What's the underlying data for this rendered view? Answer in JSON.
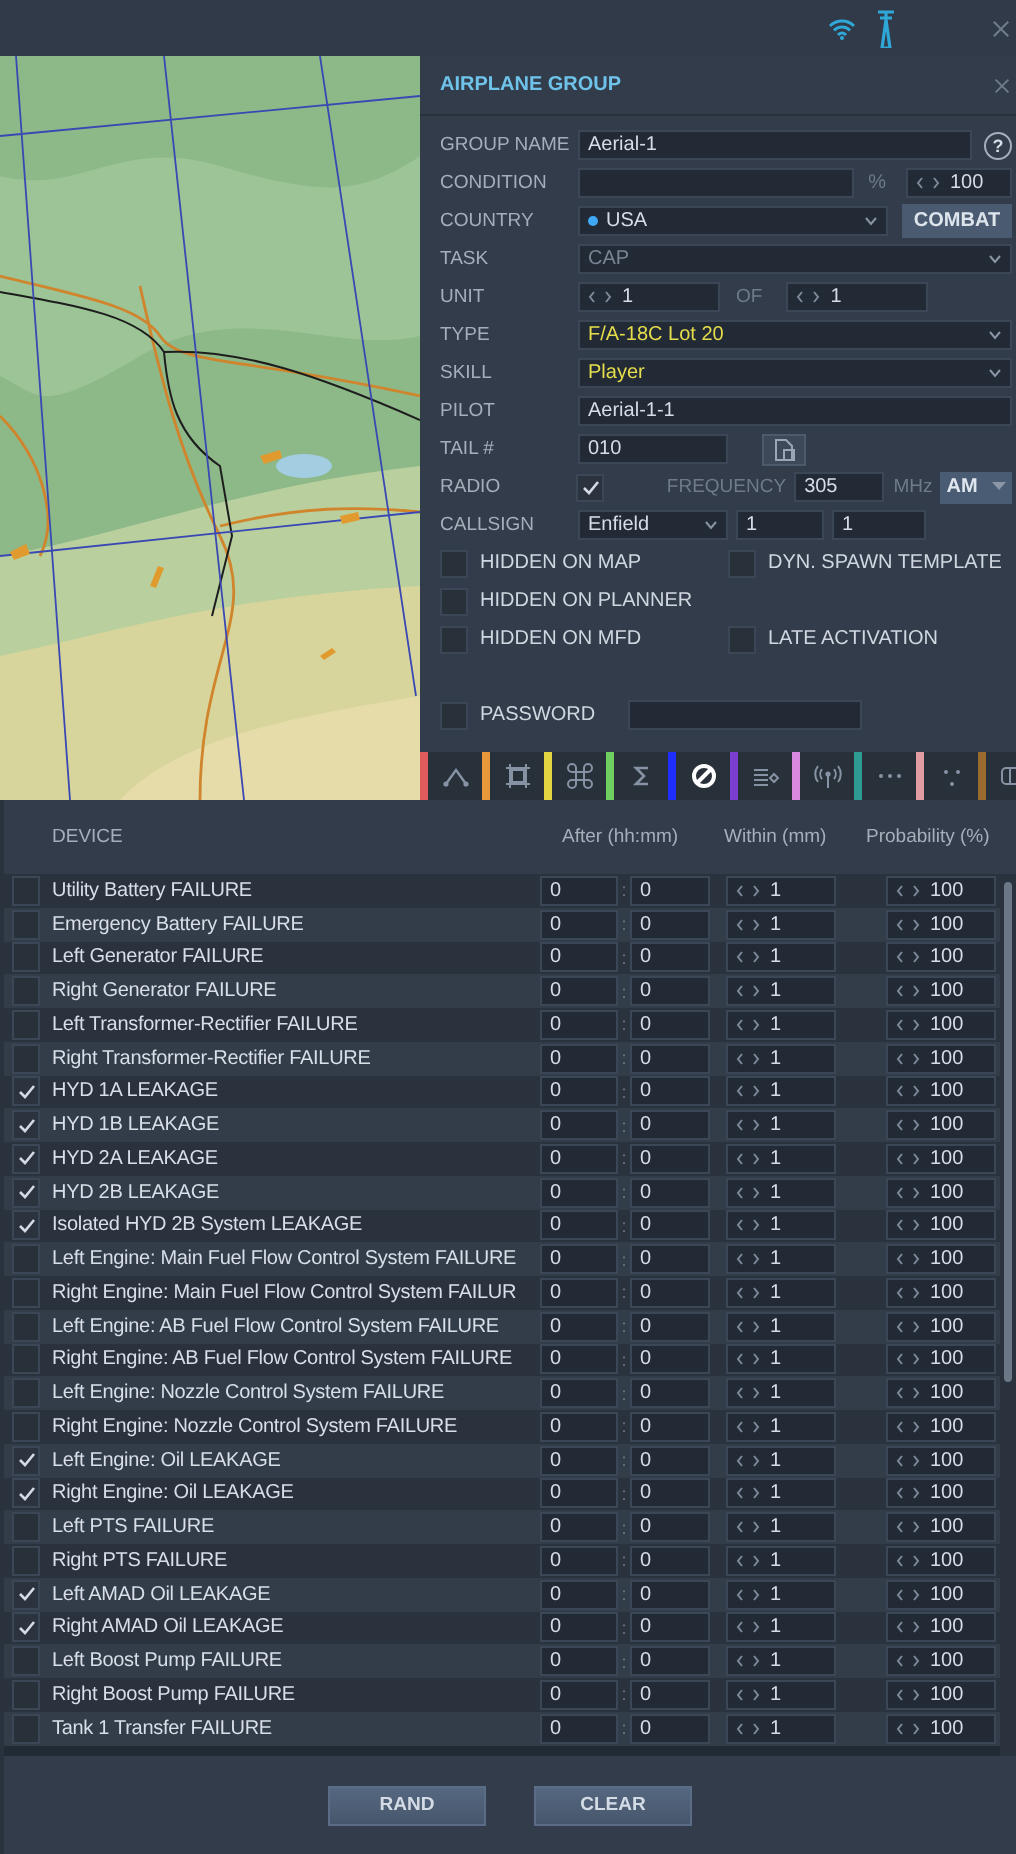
{
  "group": {
    "title": "AIRPLANE GROUP",
    "fields": [
      {
        "kind": "text",
        "label": "GROUP NAME",
        "value": "Aerial-1",
        "help": "?"
      },
      {
        "kind": "condition",
        "label": "CONDITION",
        "unit": "%",
        "amount": "100"
      },
      {
        "kind": "country",
        "label": "COUNTRY",
        "value": "USA",
        "button": "COMBAT"
      },
      {
        "kind": "dropdown",
        "label": "TASK",
        "value": "CAP",
        "disabled": true,
        "highlighted": false
      },
      {
        "kind": "count",
        "label": "UNIT",
        "value": "1",
        "of_label": "OF",
        "total": "1"
      },
      {
        "kind": "dropdown",
        "label": "TYPE",
        "value": "F/A-18C Lot 20",
        "disabled": false,
        "highlighted": true
      },
      {
        "kind": "dropdown",
        "label": "SKILL",
        "value": "Player",
        "disabled": false,
        "highlighted": true
      },
      {
        "kind": "text",
        "label": "PILOT",
        "value": "Aerial-1-1"
      },
      {
        "kind": "tail",
        "label": "TAIL #",
        "value": "010"
      },
      {
        "kind": "radio",
        "label": "RADIO",
        "checked": true,
        "freq_label": "FREQUENCY",
        "frequency": "305",
        "unit": "MHz",
        "band": "AM"
      },
      {
        "kind": "callsign",
        "label": "CALLSIGN",
        "value": "Enfield",
        "flight": "1",
        "number": "1"
      }
    ],
    "option_rows": [
      {
        "items": [
          {
            "label": "HIDDEN ON MAP",
            "checked": false
          },
          {
            "label": "DYN. SPAWN TEMPLATE",
            "checked": false
          }
        ]
      },
      {
        "items": [
          {
            "label": "HIDDEN ON PLANNER",
            "checked": false
          }
        ]
      },
      {
        "items": [
          {
            "label": "HIDDEN ON MFD",
            "checked": false
          },
          {
            "label": "LATE ACTIVATION",
            "checked": false
          }
        ]
      }
    ],
    "password": {
      "label": "PASSWORD",
      "checked": false
    },
    "toolbar": [
      {
        "color": "#e05b5b",
        "selected": false
      },
      {
        "color": "#e8973a",
        "selected": false
      },
      {
        "color": "#e3d542",
        "selected": false
      },
      {
        "color": "#6fcf5f",
        "selected": false
      },
      {
        "color": "#1f2fff",
        "selected": true
      },
      {
        "color": "#7a3fd0",
        "selected": false
      },
      {
        "color": "#d98ae0",
        "selected": false
      },
      {
        "color": "#2e9c93",
        "selected": false
      },
      {
        "color": "#e29aa3",
        "selected": false
      },
      {
        "color": "#9a6a2e",
        "selected": false
      }
    ]
  },
  "failures": {
    "columns": [
      "DEVICE",
      "After (hh:mm)",
      "Within (mm)",
      "Probability (%)"
    ],
    "rows": [
      {
        "device": "Utility Battery FAILURE",
        "checked": false,
        "after_h": "0",
        "sep": ":",
        "after_m": "0",
        "within": "1",
        "probability": "100"
      },
      {
        "device": "Emergency Battery FAILURE",
        "checked": false,
        "after_h": "0",
        "sep": ":",
        "after_m": "0",
        "within": "1",
        "probability": "100"
      },
      {
        "device": "Left Generator FAILURE",
        "checked": false,
        "after_h": "0",
        "sep": ":",
        "after_m": "0",
        "within": "1",
        "probability": "100"
      },
      {
        "device": "Right Generator FAILURE",
        "checked": false,
        "after_h": "0",
        "sep": ":",
        "after_m": "0",
        "within": "1",
        "probability": "100"
      },
      {
        "device": "Left Transformer-Rectifier FAILURE",
        "checked": false,
        "after_h": "0",
        "sep": ":",
        "after_m": "0",
        "within": "1",
        "probability": "100"
      },
      {
        "device": "Right Transformer-Rectifier FAILURE",
        "checked": false,
        "after_h": "0",
        "sep": ":",
        "after_m": "0",
        "within": "1",
        "probability": "100"
      },
      {
        "device": "HYD 1A LEAKAGE",
        "checked": true,
        "after_h": "0",
        "sep": ":",
        "after_m": "0",
        "within": "1",
        "probability": "100"
      },
      {
        "device": "HYD 1B LEAKAGE",
        "checked": true,
        "after_h": "0",
        "sep": ":",
        "after_m": "0",
        "within": "1",
        "probability": "100"
      },
      {
        "device": "HYD 2A LEAKAGE",
        "checked": true,
        "after_h": "0",
        "sep": ":",
        "after_m": "0",
        "within": "1",
        "probability": "100"
      },
      {
        "device": "HYD 2B LEAKAGE",
        "checked": true,
        "after_h": "0",
        "sep": ":",
        "after_m": "0",
        "within": "1",
        "probability": "100"
      },
      {
        "device": "Isolated HYD 2B System LEAKAGE",
        "checked": true,
        "after_h": "0",
        "sep": ":",
        "after_m": "0",
        "within": "1",
        "probability": "100"
      },
      {
        "device": "Left Engine: Main Fuel Flow Control System FAILURE",
        "checked": false,
        "after_h": "0",
        "sep": ":",
        "after_m": "0",
        "within": "1",
        "probability": "100"
      },
      {
        "device": "Right Engine: Main Fuel Flow Control System FAILUR",
        "checked": false,
        "after_h": "0",
        "sep": ":",
        "after_m": "0",
        "within": "1",
        "probability": "100"
      },
      {
        "device": "Left Engine: AB Fuel Flow Control System FAILURE",
        "checked": false,
        "after_h": "0",
        "sep": ":",
        "after_m": "0",
        "within": "1",
        "probability": "100"
      },
      {
        "device": "Right Engine: AB Fuel Flow Control System FAILURE",
        "checked": false,
        "after_h": "0",
        "sep": ":",
        "after_m": "0",
        "within": "1",
        "probability": "100"
      },
      {
        "device": "Left Engine: Nozzle Control System FAILURE",
        "checked": false,
        "after_h": "0",
        "sep": ":",
        "after_m": "0",
        "within": "1",
        "probability": "100"
      },
      {
        "device": "Right Engine: Nozzle Control System FAILURE",
        "checked": false,
        "after_h": "0",
        "sep": ":",
        "after_m": "0",
        "within": "1",
        "probability": "100"
      },
      {
        "device": "Left Engine: Oil LEAKAGE",
        "checked": true,
        "after_h": "0",
        "sep": ":",
        "after_m": "0",
        "within": "1",
        "probability": "100"
      },
      {
        "device": "Right Engine: Oil LEAKAGE",
        "checked": true,
        "after_h": "0",
        "sep": ":",
        "after_m": "0",
        "within": "1",
        "probability": "100"
      },
      {
        "device": "Left PTS FAILURE",
        "checked": false,
        "after_h": "0",
        "sep": ":",
        "after_m": "0",
        "within": "1",
        "probability": "100"
      },
      {
        "device": "Right PTS FAILURE",
        "checked": false,
        "after_h": "0",
        "sep": ":",
        "after_m": "0",
        "within": "1",
        "probability": "100"
      },
      {
        "device": "Left AMAD Oil LEAKAGE",
        "checked": true,
        "after_h": "0",
        "sep": ":",
        "after_m": "0",
        "within": "1",
        "probability": "100"
      },
      {
        "device": "Right AMAD Oil LEAKAGE",
        "checked": true,
        "after_h": "0",
        "sep": ":",
        "after_m": "0",
        "within": "1",
        "probability": "100"
      },
      {
        "device": "Left Boost Pump FAILURE",
        "checked": false,
        "after_h": "0",
        "sep": ":",
        "after_m": "0",
        "within": "1",
        "probability": "100"
      },
      {
        "device": "Right Boost Pump FAILURE",
        "checked": false,
        "after_h": "0",
        "sep": ":",
        "after_m": "0",
        "within": "1",
        "probability": "100"
      },
      {
        "device": "Tank 1 Transfer FAILURE",
        "checked": false,
        "after_h": "0",
        "sep": ":",
        "after_m": "0",
        "within": "1",
        "probability": "100"
      }
    ]
  },
  "buttons": [
    "RAND",
    "CLEAR"
  ]
}
